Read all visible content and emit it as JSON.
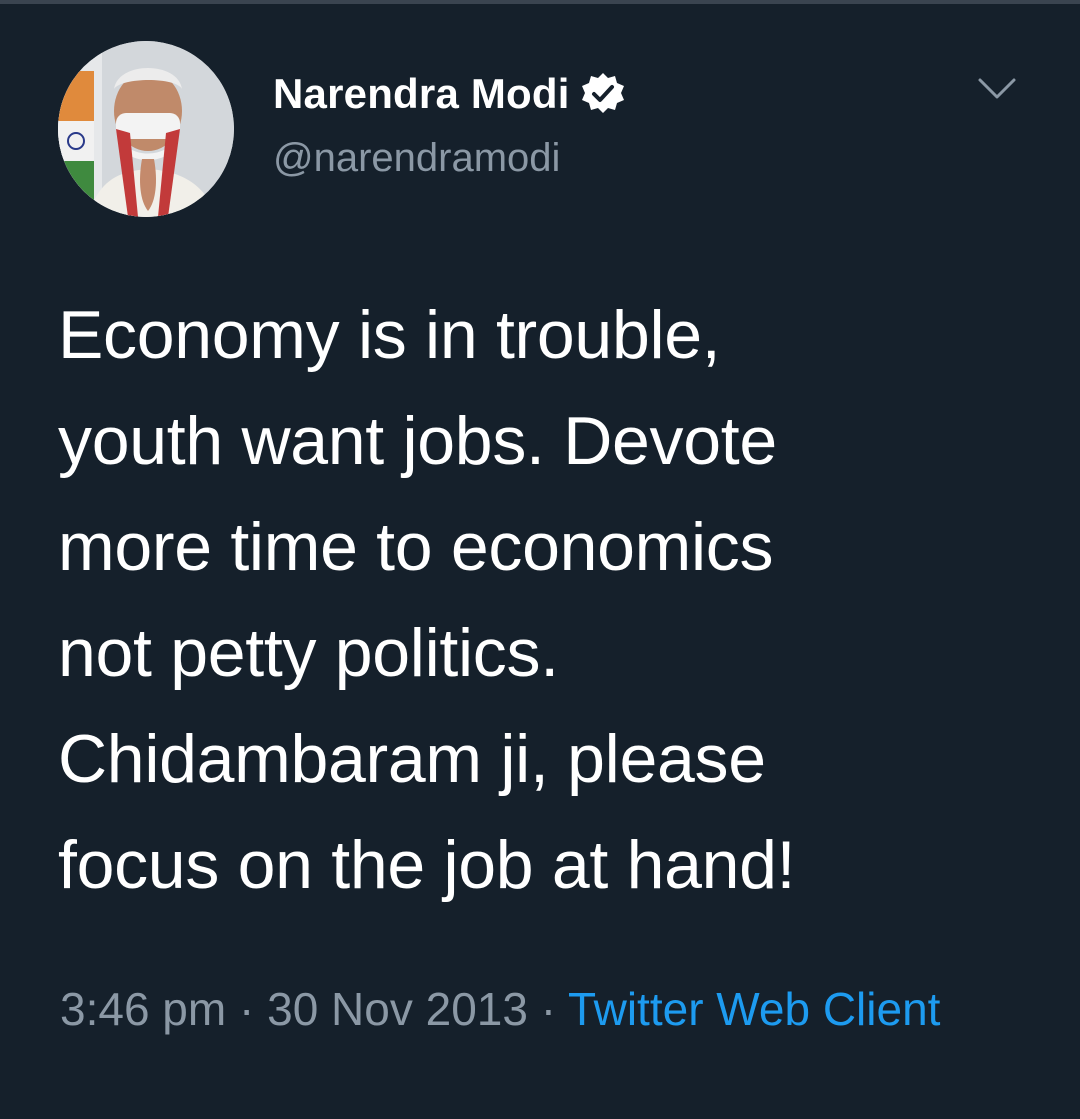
{
  "author": {
    "name": "Narendra Modi",
    "handle": "@narendramodi",
    "verified": true,
    "avatar": "profile-photo"
  },
  "tweet": {
    "lines": [
      "Economy is in trouble,",
      "youth want jobs. Devote",
      "more time to economics",
      "not petty politics.",
      "Chidambaram ji, please",
      "focus on the job at hand!"
    ]
  },
  "meta": {
    "time": "3:46 pm",
    "separator": "·",
    "date": "30 Nov 2013",
    "source": "Twitter Web Client"
  },
  "icons": {
    "verified": "verified-badge-icon",
    "menu": "chevron-down-icon"
  },
  "colors": {
    "background": "#15202b",
    "text": "#ffffff",
    "secondary": "#8b98a5",
    "link": "#1d9bf0"
  }
}
